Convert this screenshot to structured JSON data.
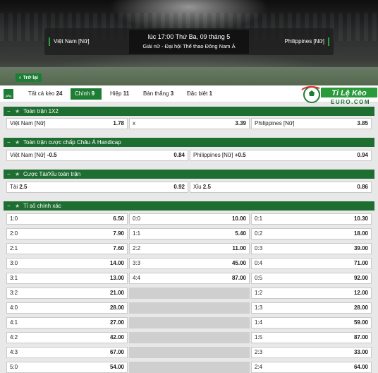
{
  "match": {
    "home": "Việt Nam [Nữ]",
    "away": "Philippines [Nữ]",
    "time": "lúc 17:00 Thứ Ba, 09 tháng 5",
    "league": "Giải nữ - Đại hội Thể thao Đông Nam Á"
  },
  "back_label": "Trở lại",
  "tabs": [
    {
      "label": "Tất cả kèo",
      "count": "24"
    },
    {
      "label": "Chính",
      "count": "9"
    },
    {
      "label": "Hiệp",
      "count": "11"
    },
    {
      "label": "Bàn thắng",
      "count": "3"
    },
    {
      "label": "Đặc biệt",
      "count": "1"
    }
  ],
  "logo": {
    "line1": "Tỉ Lệ Kèo",
    "line2": "EURO.COM"
  },
  "sections": {
    "s1x2": {
      "title": "Toàn trận 1X2",
      "cells": [
        {
          "label": "Việt Nam [Nữ]",
          "odd": "1.78"
        },
        {
          "label": "x",
          "odd": "3.39"
        },
        {
          "label": "Philippines [Nữ]",
          "odd": "3.85"
        }
      ]
    },
    "handicap": {
      "title": "Toàn trận cược chấp Châu Á Handicap",
      "cells": [
        {
          "label": "Việt Nam [Nữ]",
          "line": "-0.5",
          "odd": "0.84"
        },
        {
          "label": "Philippines [Nữ]",
          "line": "+0.5",
          "odd": "0.94"
        }
      ]
    },
    "overunder": {
      "title": "Cược Tài/Xỉu toàn trận",
      "cells": [
        {
          "label": "Tài",
          "line": "2.5",
          "odd": "0.92"
        },
        {
          "label": "Xỉu",
          "line": "2.5",
          "odd": "0.86"
        }
      ]
    },
    "correct": {
      "title": "Tỉ số chính xác",
      "col1": [
        {
          "label": "1:0",
          "odd": "6.50"
        },
        {
          "label": "2:0",
          "odd": "7.90"
        },
        {
          "label": "2:1",
          "odd": "7.60"
        },
        {
          "label": "3:0",
          "odd": "14.00"
        },
        {
          "label": "3:1",
          "odd": "13.00"
        },
        {
          "label": "3:2",
          "odd": "21.00"
        },
        {
          "label": "4:0",
          "odd": "28.00"
        },
        {
          "label": "4:1",
          "odd": "27.00"
        },
        {
          "label": "4:2",
          "odd": "42.00"
        },
        {
          "label": "4:3",
          "odd": "67.00"
        },
        {
          "label": "5:0",
          "odd": "54.00"
        }
      ],
      "col2": [
        {
          "label": "0:0",
          "odd": "10.00"
        },
        {
          "label": "1:1",
          "odd": "5.40"
        },
        {
          "label": "2:2",
          "odd": "11.00"
        },
        {
          "label": "3:3",
          "odd": "45.00"
        },
        {
          "label": "4:4",
          "odd": "87.00"
        }
      ],
      "col3": [
        {
          "label": "0:1",
          "odd": "10.30"
        },
        {
          "label": "0:2",
          "odd": "18.00"
        },
        {
          "label": "0:3",
          "odd": "39.00"
        },
        {
          "label": "0:4",
          "odd": "71.00"
        },
        {
          "label": "0:5",
          "odd": "92.00"
        },
        {
          "label": "1:2",
          "odd": "12.00"
        },
        {
          "label": "1:3",
          "odd": "28.00"
        },
        {
          "label": "1:4",
          "odd": "59.00"
        },
        {
          "label": "1:5",
          "odd": "87.00"
        },
        {
          "label": "2:3",
          "odd": "33.00"
        },
        {
          "label": "2:4",
          "odd": "64.00"
        }
      ]
    }
  },
  "colors": {
    "accent_green": "#1e7d35",
    "header_green": "#1e6e31",
    "logo_red": "#e52a2a"
  }
}
